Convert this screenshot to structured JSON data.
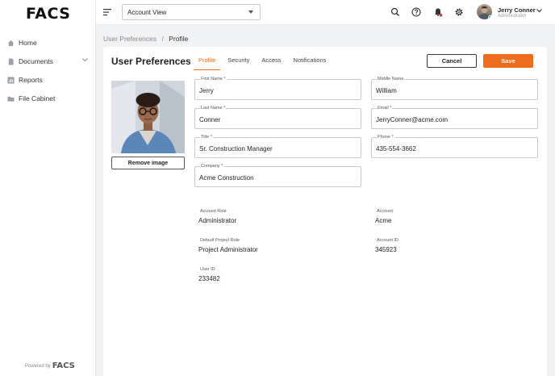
{
  "brand": {
    "logo": "FACS",
    "powered_by": "Powered by",
    "powered_logo": "FACS"
  },
  "sidebar": {
    "items": [
      {
        "label": "Home",
        "icon": "home-icon"
      },
      {
        "label": "Documents",
        "icon": "document-icon",
        "expandable": true
      },
      {
        "label": "Reports",
        "icon": "reports-icon"
      },
      {
        "label": "File Cabinet",
        "icon": "folder-icon"
      }
    ]
  },
  "topbar": {
    "view_select": "Account View",
    "user": {
      "name": "Jerry Conner",
      "role": "Administrator",
      "status_color": "#21b24b"
    }
  },
  "breadcrumb": {
    "parent": "User Preferences",
    "separator": "/",
    "current": "Profile"
  },
  "page": {
    "title": "User Preferences",
    "tabs": [
      "Profile",
      "Security",
      "Access",
      "Notifications"
    ],
    "active_tab": "Profile",
    "cancel_label": "Cancel",
    "save_label": "Save",
    "remove_image_label": "Remove image",
    "accent_color": "#ef6c1e"
  },
  "form": {
    "first_name": {
      "label": "First Name *",
      "value": "Jerry"
    },
    "middle_name": {
      "label": "Middle Name",
      "value": "William"
    },
    "last_name": {
      "label": "Last Name *",
      "value": "Conner"
    },
    "email": {
      "label": "Email *",
      "value": "JerryConner@acme.com"
    },
    "title": {
      "label": "Title *",
      "value": "Sr. Construction Manager"
    },
    "phone": {
      "label": "Phone *",
      "value": "435-554-3662"
    },
    "company": {
      "label": "Company *",
      "value": "Acme Construction"
    }
  },
  "readonly": {
    "account_role": {
      "label": "Account Role",
      "value": "Administrator"
    },
    "account": {
      "label": "Account",
      "value": "Acme"
    },
    "default_project_role": {
      "label": "Default Project Role",
      "value": "Project Administrator"
    },
    "account_id": {
      "label": "Account  ID",
      "value": "345923"
    },
    "user_id": {
      "label": "User ID",
      "value": "233482"
    }
  }
}
